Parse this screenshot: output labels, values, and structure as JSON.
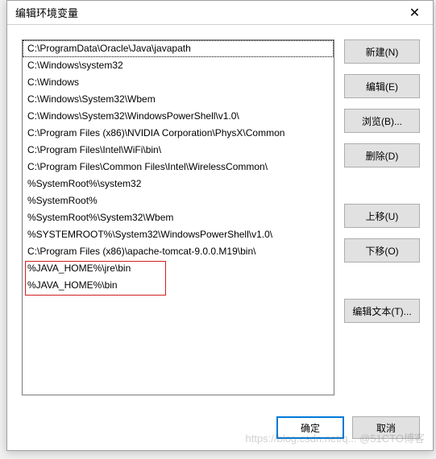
{
  "dialog": {
    "title": "编辑环境变量"
  },
  "list": {
    "items": [
      "C:\\ProgramData\\Oracle\\Java\\javapath",
      "C:\\Windows\\system32",
      "C:\\Windows",
      "C:\\Windows\\System32\\Wbem",
      "C:\\Windows\\System32\\WindowsPowerShell\\v1.0\\",
      "C:\\Program Files (x86)\\NVIDIA Corporation\\PhysX\\Common",
      "C:\\Program Files\\Intel\\WiFi\\bin\\",
      "C:\\Program Files\\Common Files\\Intel\\WirelessCommon\\",
      "%SystemRoot%\\system32",
      "%SystemRoot%",
      "%SystemRoot%\\System32\\Wbem",
      "%SYSTEMROOT%\\System32\\WindowsPowerShell\\v1.0\\",
      "C:\\Program Files (x86)\\apache-tomcat-9.0.0.M19\\bin\\",
      "%JAVA_HOME%\\jre\\bin",
      "%JAVA_HOME%\\bin"
    ],
    "selected_index": 0
  },
  "buttons": {
    "new": "新建(N)",
    "edit": "编辑(E)",
    "browse": "浏览(B)...",
    "delete": "删除(D)",
    "move_up": "上移(U)",
    "move_down": "下移(O)",
    "edit_text": "编辑文本(T)..."
  },
  "footer": {
    "ok": "确定",
    "cancel": "取消"
  },
  "watermark": "https://blog.csdn.net/q... @51CTO博客"
}
